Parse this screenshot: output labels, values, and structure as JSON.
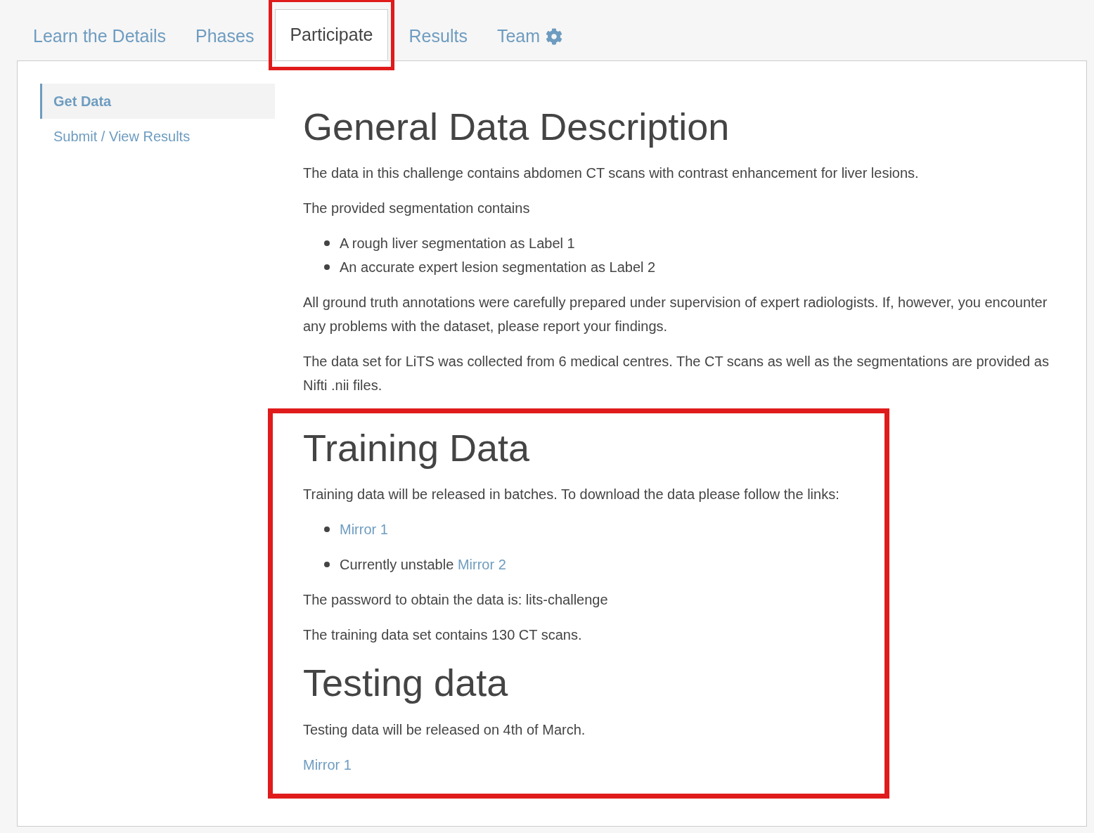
{
  "tabs": [
    {
      "label": "Learn the Details",
      "selected": false,
      "highlighted": false,
      "kind": "plain"
    },
    {
      "label": "Phases",
      "selected": false,
      "highlighted": false,
      "kind": "plain"
    },
    {
      "label": "Participate",
      "selected": true,
      "highlighted": true,
      "kind": "plain"
    },
    {
      "label": "Results",
      "selected": false,
      "highlighted": false,
      "kind": "plain"
    },
    {
      "label": "Team",
      "selected": false,
      "highlighted": false,
      "kind": "settings"
    }
  ],
  "sidebar": {
    "items": [
      {
        "label": "Get Data",
        "selected": true
      },
      {
        "label": "Submit / View Results",
        "selected": false
      }
    ]
  },
  "sections": [
    {
      "highlighted": false,
      "blocks": [
        {
          "kind": "heading",
          "text": "General Data Description"
        },
        {
          "kind": "paragraph",
          "parts": [
            {
              "text": "The data in this challenge contains abdomen CT scans with contrast enhancement for liver lesions.",
              "link": false
            }
          ]
        },
        {
          "kind": "paragraph",
          "parts": [
            {
              "text": "The provided segmentation contains",
              "link": false
            }
          ]
        },
        {
          "kind": "bullets",
          "items": [
            [
              {
                "text": "A rough liver segmentation as Label 1",
                "link": false
              }
            ],
            [
              {
                "text": "An accurate expert lesion segmentation as Label 2",
                "link": false
              }
            ]
          ]
        },
        {
          "kind": "paragraph",
          "parts": [
            {
              "text": "All ground truth annotations were carefully prepared under supervision of expert radiologists. If, however, you encounter any problems with the dataset, please report your findings.",
              "link": false
            }
          ]
        },
        {
          "kind": "paragraph",
          "parts": [
            {
              "text": "The data set for LiTS was collected from 6 medical centres. The CT scans as well as the segmentations are provided as Nifti .nii files.",
              "link": false
            }
          ]
        }
      ]
    },
    {
      "highlighted": true,
      "blocks": [
        {
          "kind": "heading",
          "text": "Training Data"
        },
        {
          "kind": "paragraph",
          "parts": [
            {
              "text": "Training data will be released in batches. To download the data please follow the links:",
              "link": false
            }
          ]
        },
        {
          "kind": "bullets",
          "loose": true,
          "items": [
            [
              {
                "text": "Mirror 1",
                "link": true
              }
            ],
            [
              {
                "text": "Currently unstable",
                "link": false
              },
              {
                "text": "Mirror 2",
                "link": true
              }
            ]
          ]
        },
        {
          "kind": "paragraph",
          "parts": [
            {
              "text": "The password to obtain the data is: lits-challenge",
              "link": false
            }
          ]
        },
        {
          "kind": "paragraph",
          "parts": [
            {
              "text": "The training data set contains 130 CT scans.",
              "link": false
            }
          ]
        },
        {
          "kind": "heading",
          "text": "Testing data"
        },
        {
          "kind": "paragraph",
          "parts": [
            {
              "text": "Testing data will be released on 4th of March.",
              "link": false
            }
          ]
        },
        {
          "kind": "paragraph",
          "parts": [
            {
              "text": "Mirror 1",
              "link": true
            }
          ]
        }
      ]
    }
  ]
}
